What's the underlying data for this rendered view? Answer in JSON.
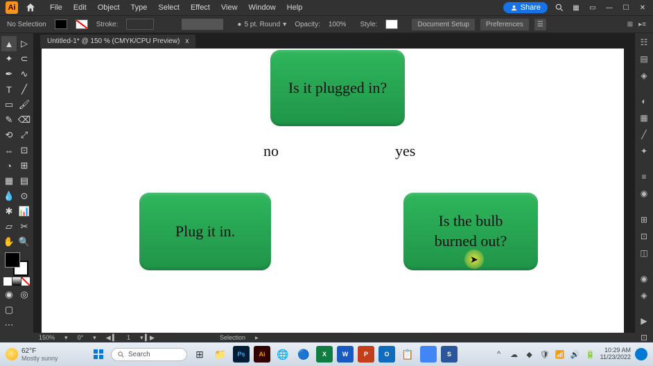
{
  "chart_data": {
    "type": "flowchart",
    "nodes": [
      {
        "id": "q1",
        "text": "Is it plugged in?",
        "shape": "rounded-rect"
      },
      {
        "id": "a1",
        "text": "Plug it in.",
        "shape": "rounded-rect"
      },
      {
        "id": "q2",
        "text": "Is the bulb burned out?",
        "shape": "rounded-rect"
      }
    ],
    "edges": [
      {
        "from": "q1",
        "to": "a1",
        "label": "no"
      },
      {
        "from": "q1",
        "to": "q2",
        "label": "yes"
      }
    ]
  },
  "menubar": {
    "logo": "Ai",
    "items": [
      "File",
      "Edit",
      "Object",
      "Type",
      "Select",
      "Effect",
      "View",
      "Window",
      "Help"
    ],
    "share": "Share"
  },
  "controlbar": {
    "selection": "No Selection",
    "stroke_label": "Stroke:",
    "stroke_weight": "5 pt. Round",
    "opacity_label": "Opacity:",
    "opacity_value": "100%",
    "style_label": "Style:",
    "doc_setup": "Document Setup",
    "preferences": "Preferences"
  },
  "tab": {
    "title": "Untitled-1* @ 150 % (CMYK/CPU Preview)"
  },
  "statusbar": {
    "zoom": "150%",
    "rotation": "0°",
    "artboard": "1",
    "tool": "Selection"
  },
  "flowchart": {
    "q1": "Is it plugged in?",
    "a1": "Plug it in.",
    "q2": "Is the bulb\nburned out?",
    "no": "no",
    "yes": "yes"
  },
  "taskbar": {
    "temp": "62°F",
    "weather": "Mostly sunny",
    "search": "Search",
    "time": "10:29 AM",
    "date": "11/23/2022"
  }
}
